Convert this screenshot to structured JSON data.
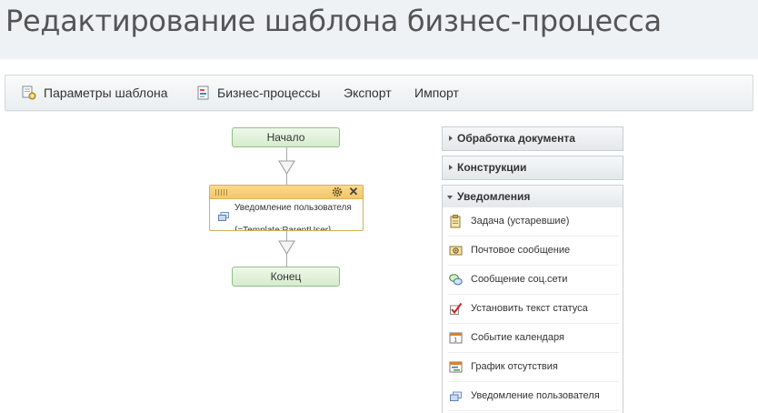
{
  "page": {
    "title": "Редактирование шаблона бизнес-процесса"
  },
  "toolbar": {
    "items": [
      {
        "label": "Параметры шаблона",
        "icon": "template-settings-icon"
      },
      {
        "label": "Бизнес-процессы",
        "icon": "business-process-icon"
      },
      {
        "label": "Экспорт"
      },
      {
        "label": "Импорт"
      }
    ]
  },
  "workflow": {
    "start_label": "Начало",
    "end_label": "Конец",
    "activity": {
      "title": "Уведомление пользователя",
      "clipped_line": "{=Template:ParentUser}"
    }
  },
  "panel": {
    "groups": [
      {
        "label": "Обработка документа",
        "expanded": false
      },
      {
        "label": "Конструкции",
        "expanded": false
      },
      {
        "label": "Уведомления",
        "expanded": true,
        "items": [
          {
            "label": "Задача (устаревшие)",
            "icon": "task-icon"
          },
          {
            "label": "Почтовое сообщение",
            "icon": "mail-icon"
          },
          {
            "label": "Сообщение соц.сети",
            "icon": "chat-bubbles-icon"
          },
          {
            "label": "Установить текст статуса",
            "icon": "checkmark-icon"
          },
          {
            "label": "Событие календаря",
            "icon": "calendar-icon"
          },
          {
            "label": "График отсутствия",
            "icon": "absence-chart-icon"
          },
          {
            "label": "Уведомление пользователя",
            "icon": "user-notification-icon"
          }
        ]
      }
    ]
  },
  "colors": {
    "header_bg": "#eef2f4",
    "start_end_green": "#d5eccd",
    "activity_orange": "#f4c766",
    "connector_gray": "#aaaaaa"
  }
}
